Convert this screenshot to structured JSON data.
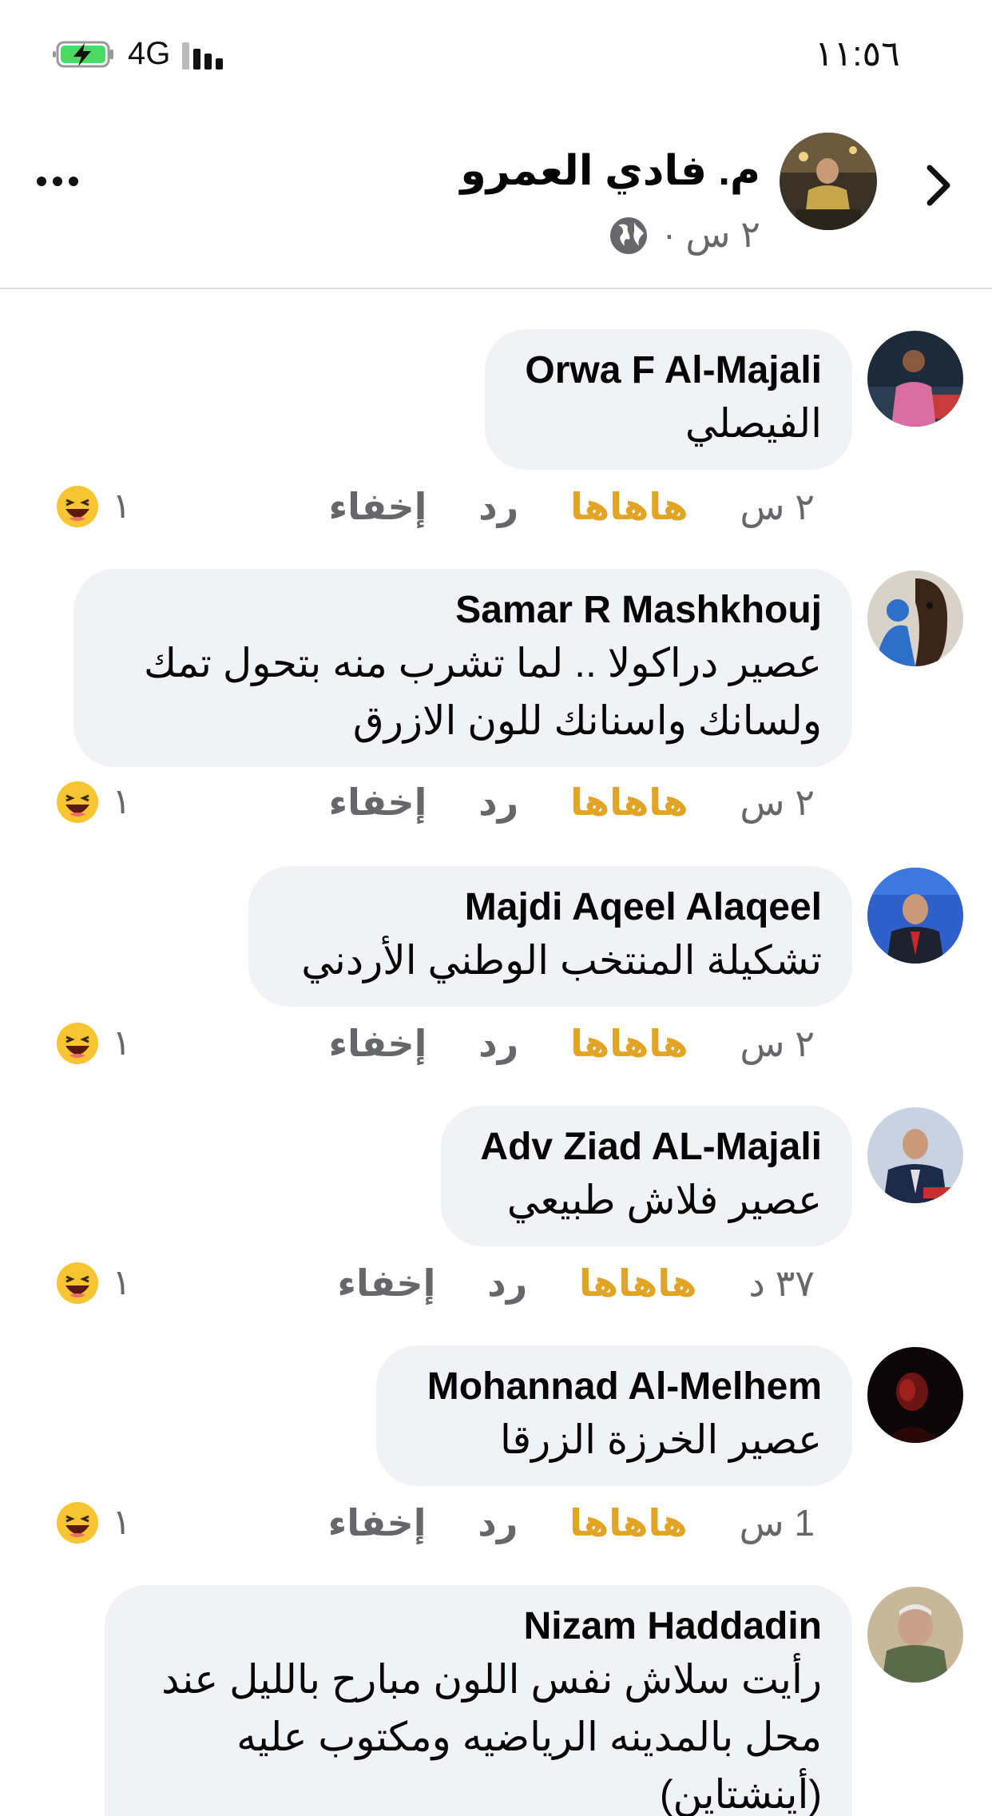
{
  "status_bar": {
    "time": "١١:٥٦",
    "network": "4G"
  },
  "header": {
    "author_name": "م. فادي العمرو",
    "post_time": "٢ س ·"
  },
  "comments": [
    {
      "author": "Orwa F Al-Majali",
      "text": "الفيصلي",
      "time": "٢ س",
      "reaction_label": "هاهاها",
      "reply_label": "رد",
      "hide_label": "إخفاء",
      "reaction_count": "١"
    },
    {
      "author": "Samar R Mashkhouj",
      "text": "عصير دراكولا .. لما تشرب منه بتحول تمك ولسانك واسنانك للون الازرق",
      "time": "٢ س",
      "reaction_label": "هاهاها",
      "reply_label": "رد",
      "hide_label": "إخفاء",
      "reaction_count": "١"
    },
    {
      "author": "Majdi Aqeel Alaqeel",
      "text": "تشكيلة المنتخب الوطني الأردني",
      "time": "٢ س",
      "reaction_label": "هاهاها",
      "reply_label": "رد",
      "hide_label": "إخفاء",
      "reaction_count": "١"
    },
    {
      "author": "Adv Ziad AL-Majali",
      "text": "عصير فلاش طبيعي",
      "time": "٣٧ د",
      "reaction_label": "هاهاها",
      "reply_label": "رد",
      "hide_label": "إخفاء",
      "reaction_count": "١"
    },
    {
      "author": "Mohannad Al-Melhem",
      "text": "عصير الخرزة الزرقا",
      "time": "1 س",
      "reaction_label": "هاهاها",
      "reply_label": "رد",
      "hide_label": "إخفاء",
      "reaction_count": "١"
    },
    {
      "author": "Nizam Haddadin",
      "text": "رأيت سلاش نفس اللون مبارح بالليل عند محل بالمدينه الرياضيه ومكتوب عليه (أينشتاين)"
    }
  ],
  "icons": {
    "back": "chevron-right-icon",
    "more": "more-dots-icon",
    "privacy": "globe-icon",
    "reaction": "haha-emoji-icon",
    "battery": "battery-charging-icon",
    "signal": "signal-bars-icon"
  },
  "colors": {
    "bubble": "#f0f2f5",
    "reaction_active": "#e2a424",
    "secondary_text": "#65676b",
    "divider": "#dadde1"
  }
}
